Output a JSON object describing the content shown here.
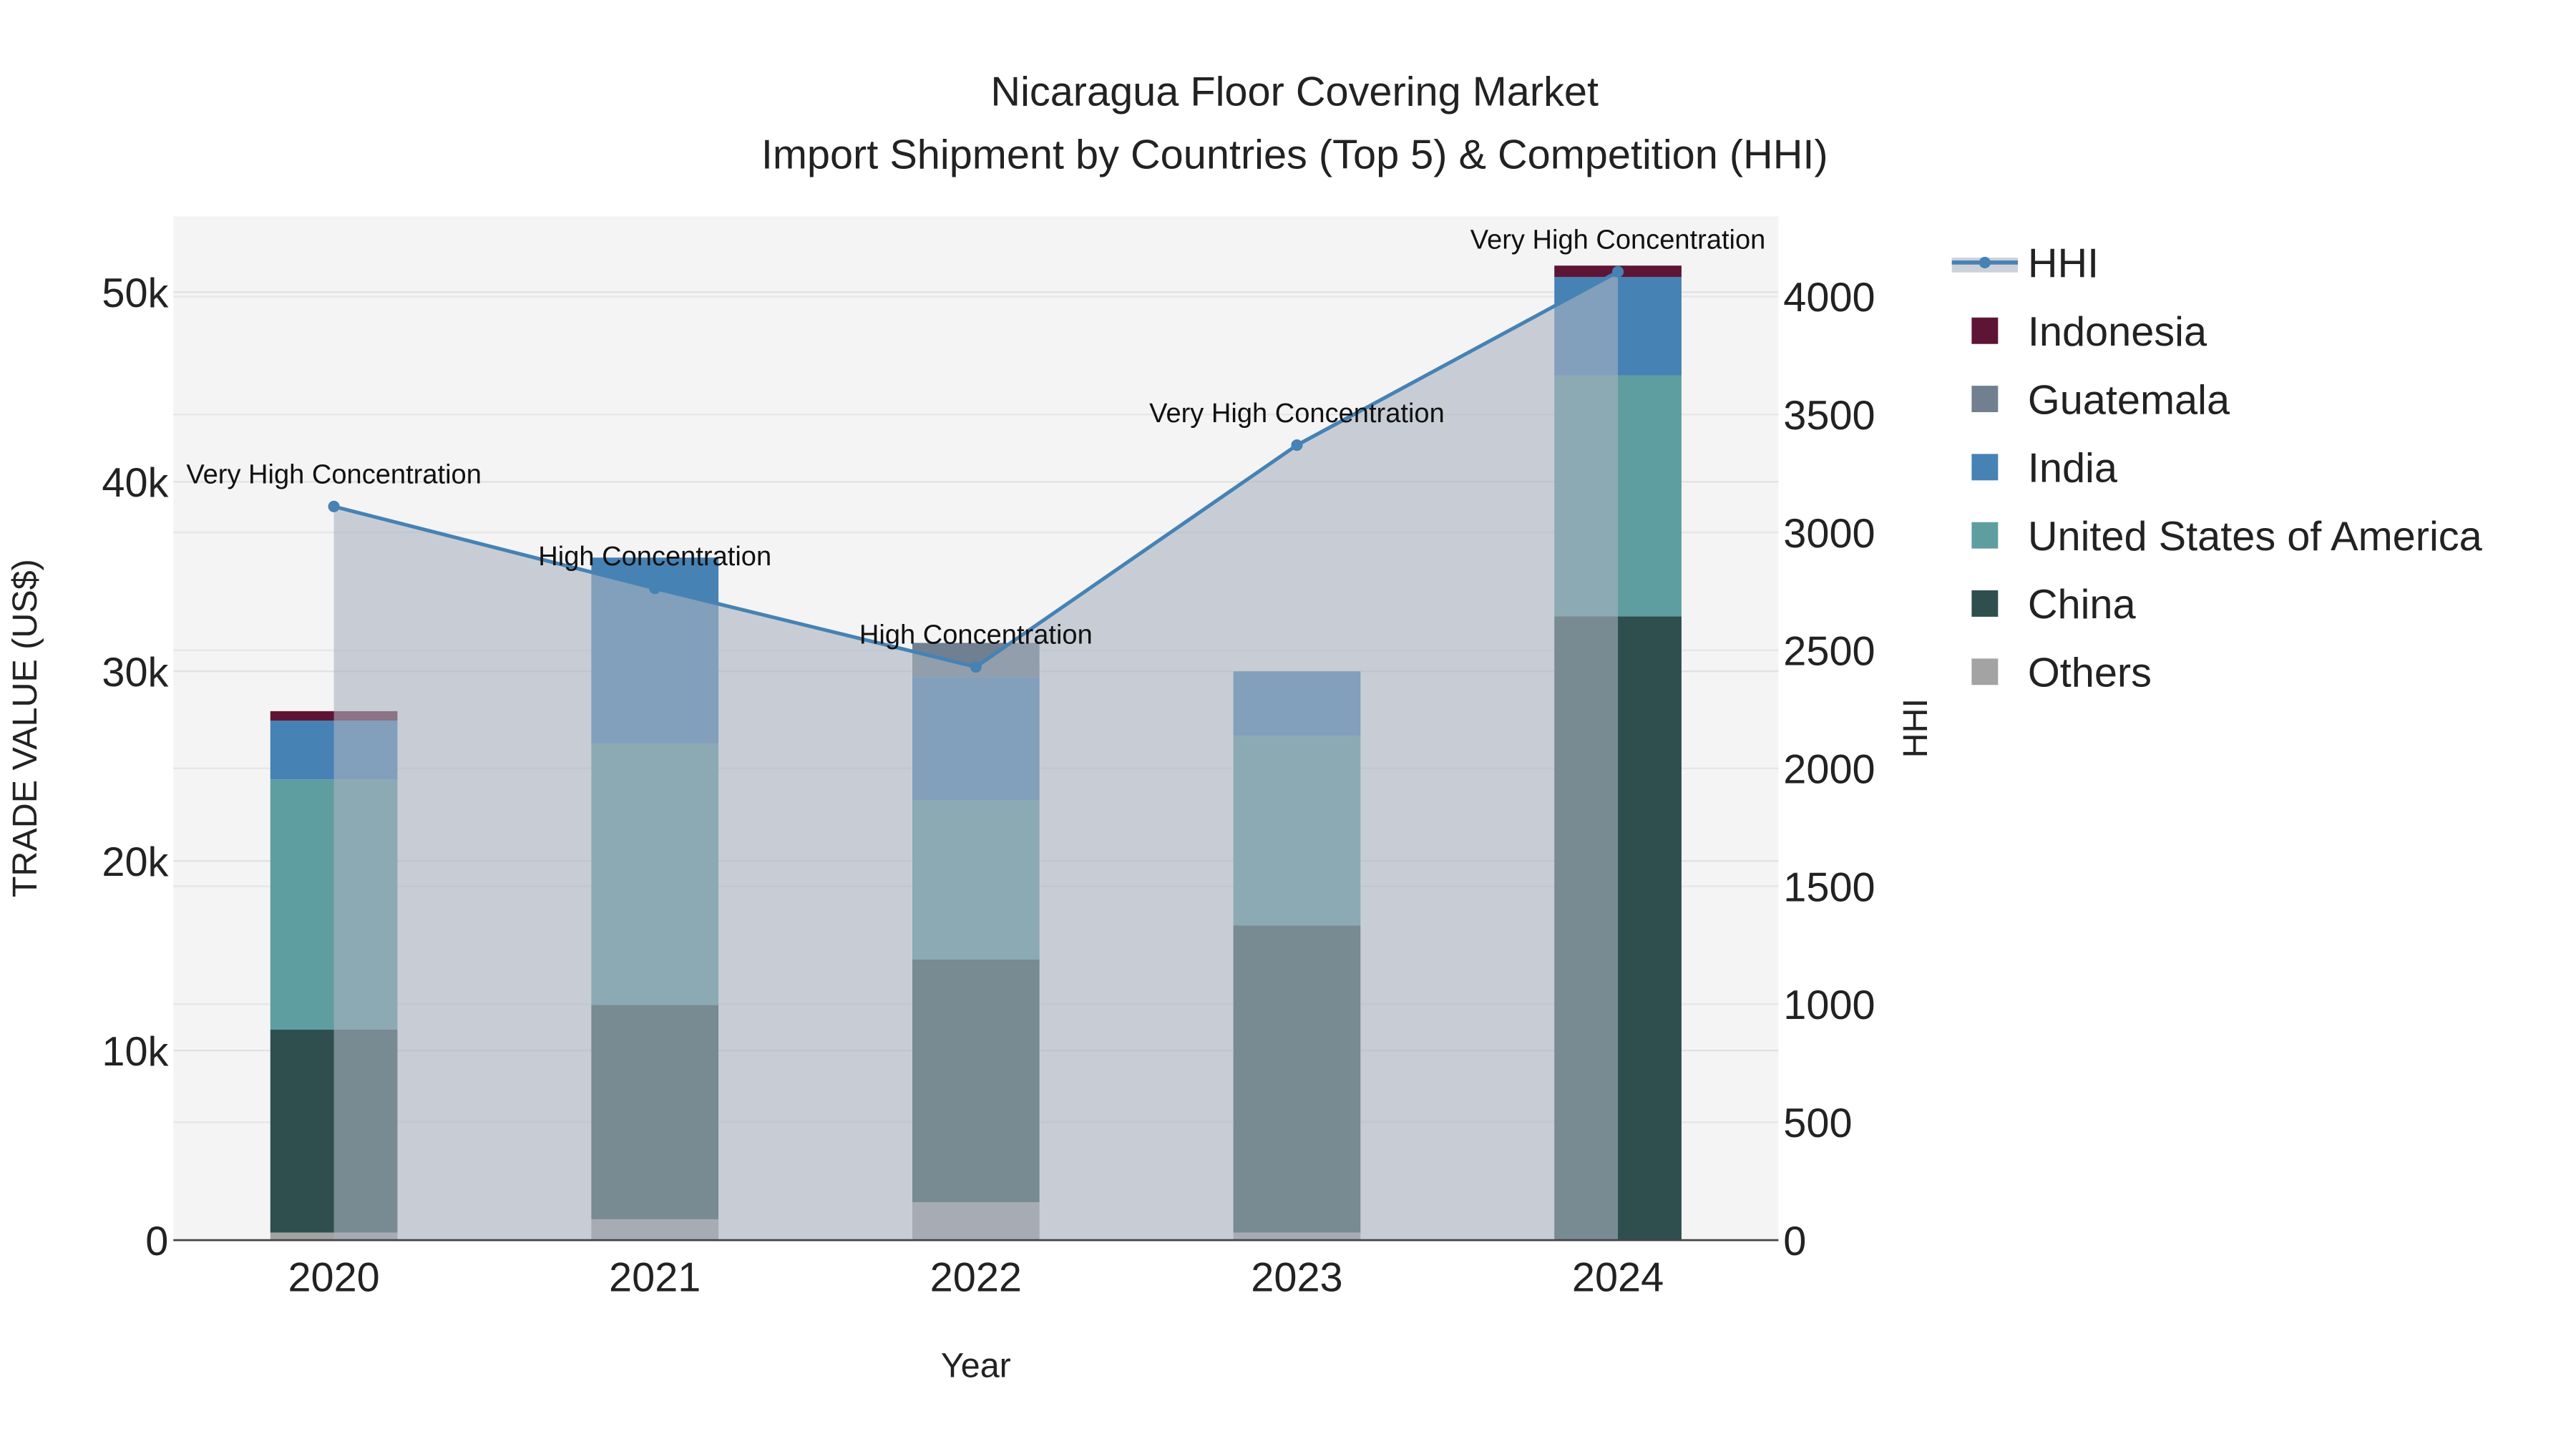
{
  "chart_data": {
    "type": "bar",
    "title": "Nicaragua Floor Covering Market",
    "subtitle": "Import Shipment by Countries (Top 5) & Competition (HHI)",
    "xlabel": "Year",
    "ylabel": "TRADE VALUE (US$)",
    "y2label": "HHI",
    "ylim": [
      0,
      54000
    ],
    "y2lim": [
      0,
      4340
    ],
    "categories": [
      "2020",
      "2021",
      "2022",
      "2023",
      "2024"
    ],
    "yticks": [
      0,
      10000,
      20000,
      30000,
      40000,
      50000
    ],
    "ytick_labels": [
      "0",
      "10k",
      "20k",
      "30k",
      "40k",
      "50k"
    ],
    "y2ticks": [
      0,
      500,
      1000,
      1500,
      2000,
      2500,
      3000,
      3500,
      4000
    ],
    "y2tick_labels": [
      "0",
      "500",
      "1000",
      "1500",
      "2000",
      "2500",
      "3000",
      "3500",
      "4000"
    ],
    "stacked": true,
    "series": [
      {
        "name": "Others",
        "color": "#a3a3a3",
        "values": [
          400,
          1100,
          2000,
          400,
          0
        ]
      },
      {
        "name": "China",
        "color": "#2f4f4f",
        "values": [
          10700,
          11300,
          12800,
          16200,
          32900
        ]
      },
      {
        "name": "United States of America",
        "color": "#5f9ea0",
        "values": [
          13200,
          13800,
          8400,
          10000,
          12700
        ]
      },
      {
        "name": "India",
        "color": "#4682b4",
        "values": [
          3100,
          9800,
          6500,
          3400,
          5200
        ]
      },
      {
        "name": "Guatemala",
        "color": "#708090",
        "values": [
          0,
          0,
          1800,
          0,
          0
        ]
      },
      {
        "name": "Indonesia",
        "color": "#5e1535",
        "values": [
          500,
          0,
          0,
          0,
          600
        ]
      }
    ],
    "hhi": {
      "name": "HHI",
      "color": "#4682b4",
      "values": [
        3110,
        2763,
        2430,
        3370,
        4105
      ],
      "annotations": [
        "Very High Concentration",
        "High Concentration",
        "High Concentration",
        "Very High Concentration",
        "Very High Concentration"
      ]
    },
    "legend": [
      "HHI",
      "Indonesia",
      "Guatemala",
      "India",
      "United States of America",
      "China",
      "Others"
    ],
    "legend_position": "right",
    "grid": true
  }
}
